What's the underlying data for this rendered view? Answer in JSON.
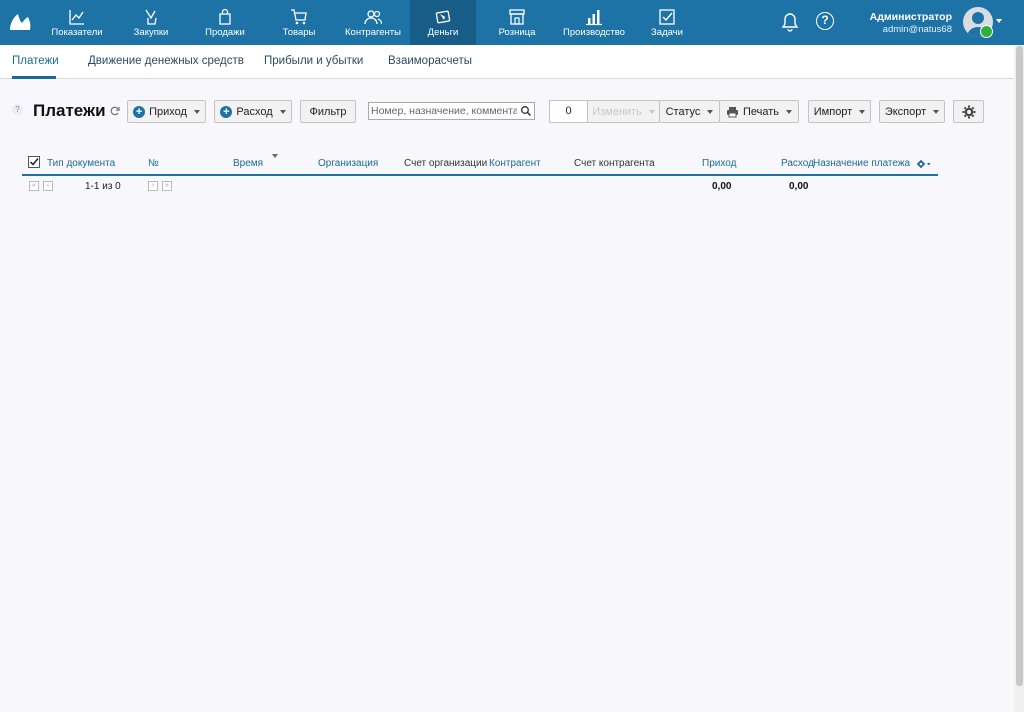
{
  "nav": {
    "items": [
      {
        "label": "Показатели",
        "icon": "chart-line-icon"
      },
      {
        "label": "Закупки",
        "icon": "bag-icon"
      },
      {
        "label": "Продажи",
        "icon": "shopping-bag-icon"
      },
      {
        "label": "Товары",
        "icon": "cart-icon"
      },
      {
        "label": "Контрагенты",
        "icon": "users-icon"
      },
      {
        "label": "Деньги",
        "icon": "money-icon"
      },
      {
        "label": "Розница",
        "icon": "store-icon"
      },
      {
        "label": "Производство",
        "icon": "factory-icon"
      },
      {
        "label": "Задачи",
        "icon": "checkbox-icon"
      }
    ],
    "active_index": 5
  },
  "user": {
    "name": "Администратор",
    "login": "admin@natus68"
  },
  "subtabs": [
    "Платежи",
    "Движение денежных средств",
    "Прибыли и убытки",
    "Взаиморасчеты"
  ],
  "toolbar": {
    "title": "Платежи",
    "income_label": "Приход",
    "expense_label": "Расход",
    "filter_label": "Фильтр",
    "search_placeholder": "Номер, назначение, комментарий",
    "selected_count": "0",
    "change_label": "Изменить",
    "status_label": "Статус",
    "print_label": "Печать",
    "import_label": "Импорт",
    "export_label": "Экспорт"
  },
  "table": {
    "columns": [
      "Тип документа",
      "№",
      "Время",
      "Организация",
      "Счет организации",
      "Контрагент",
      "Счет контрагента",
      "Приход",
      "Расход",
      "Назначение платежа"
    ],
    "pagination": "1-1 из 0",
    "total_income": "0,00",
    "total_expense": "0,00"
  },
  "colors": {
    "brand": "#1e73a6",
    "active_nav": "#175d88"
  }
}
